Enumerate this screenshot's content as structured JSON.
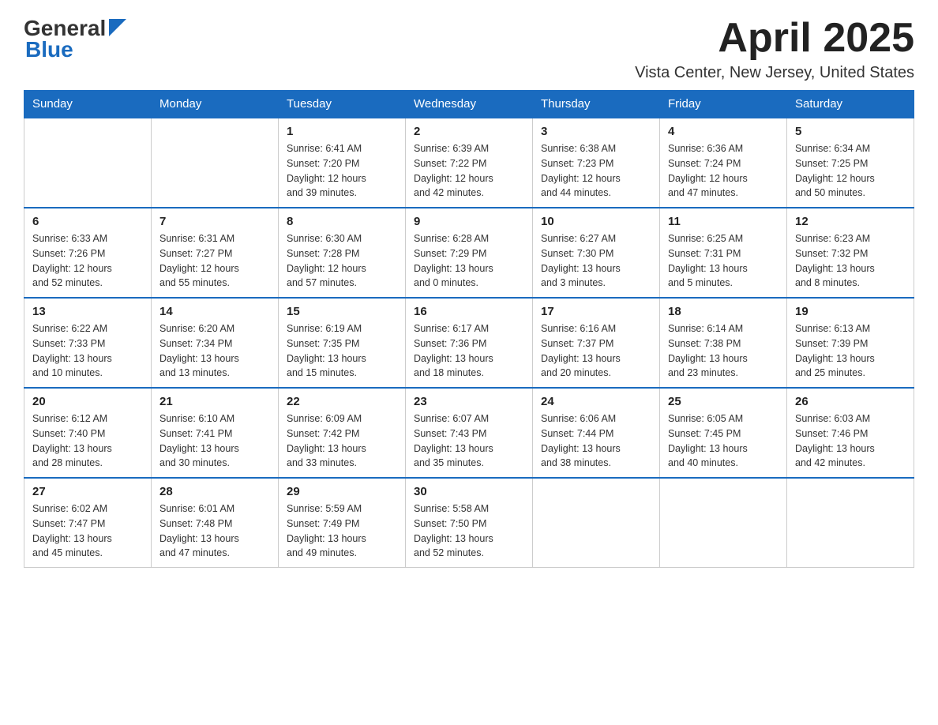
{
  "header": {
    "logo_line1": "General",
    "logo_line2": "Blue",
    "month": "April 2025",
    "location": "Vista Center, New Jersey, United States"
  },
  "weekdays": [
    "Sunday",
    "Monday",
    "Tuesday",
    "Wednesday",
    "Thursday",
    "Friday",
    "Saturday"
  ],
  "weeks": [
    [
      {
        "day": "",
        "info": ""
      },
      {
        "day": "",
        "info": ""
      },
      {
        "day": "1",
        "info": "Sunrise: 6:41 AM\nSunset: 7:20 PM\nDaylight: 12 hours\nand 39 minutes."
      },
      {
        "day": "2",
        "info": "Sunrise: 6:39 AM\nSunset: 7:22 PM\nDaylight: 12 hours\nand 42 minutes."
      },
      {
        "day": "3",
        "info": "Sunrise: 6:38 AM\nSunset: 7:23 PM\nDaylight: 12 hours\nand 44 minutes."
      },
      {
        "day": "4",
        "info": "Sunrise: 6:36 AM\nSunset: 7:24 PM\nDaylight: 12 hours\nand 47 minutes."
      },
      {
        "day": "5",
        "info": "Sunrise: 6:34 AM\nSunset: 7:25 PM\nDaylight: 12 hours\nand 50 minutes."
      }
    ],
    [
      {
        "day": "6",
        "info": "Sunrise: 6:33 AM\nSunset: 7:26 PM\nDaylight: 12 hours\nand 52 minutes."
      },
      {
        "day": "7",
        "info": "Sunrise: 6:31 AM\nSunset: 7:27 PM\nDaylight: 12 hours\nand 55 minutes."
      },
      {
        "day": "8",
        "info": "Sunrise: 6:30 AM\nSunset: 7:28 PM\nDaylight: 12 hours\nand 57 minutes."
      },
      {
        "day": "9",
        "info": "Sunrise: 6:28 AM\nSunset: 7:29 PM\nDaylight: 13 hours\nand 0 minutes."
      },
      {
        "day": "10",
        "info": "Sunrise: 6:27 AM\nSunset: 7:30 PM\nDaylight: 13 hours\nand 3 minutes."
      },
      {
        "day": "11",
        "info": "Sunrise: 6:25 AM\nSunset: 7:31 PM\nDaylight: 13 hours\nand 5 minutes."
      },
      {
        "day": "12",
        "info": "Sunrise: 6:23 AM\nSunset: 7:32 PM\nDaylight: 13 hours\nand 8 minutes."
      }
    ],
    [
      {
        "day": "13",
        "info": "Sunrise: 6:22 AM\nSunset: 7:33 PM\nDaylight: 13 hours\nand 10 minutes."
      },
      {
        "day": "14",
        "info": "Sunrise: 6:20 AM\nSunset: 7:34 PM\nDaylight: 13 hours\nand 13 minutes."
      },
      {
        "day": "15",
        "info": "Sunrise: 6:19 AM\nSunset: 7:35 PM\nDaylight: 13 hours\nand 15 minutes."
      },
      {
        "day": "16",
        "info": "Sunrise: 6:17 AM\nSunset: 7:36 PM\nDaylight: 13 hours\nand 18 minutes."
      },
      {
        "day": "17",
        "info": "Sunrise: 6:16 AM\nSunset: 7:37 PM\nDaylight: 13 hours\nand 20 minutes."
      },
      {
        "day": "18",
        "info": "Sunrise: 6:14 AM\nSunset: 7:38 PM\nDaylight: 13 hours\nand 23 minutes."
      },
      {
        "day": "19",
        "info": "Sunrise: 6:13 AM\nSunset: 7:39 PM\nDaylight: 13 hours\nand 25 minutes."
      }
    ],
    [
      {
        "day": "20",
        "info": "Sunrise: 6:12 AM\nSunset: 7:40 PM\nDaylight: 13 hours\nand 28 minutes."
      },
      {
        "day": "21",
        "info": "Sunrise: 6:10 AM\nSunset: 7:41 PM\nDaylight: 13 hours\nand 30 minutes."
      },
      {
        "day": "22",
        "info": "Sunrise: 6:09 AM\nSunset: 7:42 PM\nDaylight: 13 hours\nand 33 minutes."
      },
      {
        "day": "23",
        "info": "Sunrise: 6:07 AM\nSunset: 7:43 PM\nDaylight: 13 hours\nand 35 minutes."
      },
      {
        "day": "24",
        "info": "Sunrise: 6:06 AM\nSunset: 7:44 PM\nDaylight: 13 hours\nand 38 minutes."
      },
      {
        "day": "25",
        "info": "Sunrise: 6:05 AM\nSunset: 7:45 PM\nDaylight: 13 hours\nand 40 minutes."
      },
      {
        "day": "26",
        "info": "Sunrise: 6:03 AM\nSunset: 7:46 PM\nDaylight: 13 hours\nand 42 minutes."
      }
    ],
    [
      {
        "day": "27",
        "info": "Sunrise: 6:02 AM\nSunset: 7:47 PM\nDaylight: 13 hours\nand 45 minutes."
      },
      {
        "day": "28",
        "info": "Sunrise: 6:01 AM\nSunset: 7:48 PM\nDaylight: 13 hours\nand 47 minutes."
      },
      {
        "day": "29",
        "info": "Sunrise: 5:59 AM\nSunset: 7:49 PM\nDaylight: 13 hours\nand 49 minutes."
      },
      {
        "day": "30",
        "info": "Sunrise: 5:58 AM\nSunset: 7:50 PM\nDaylight: 13 hours\nand 52 minutes."
      },
      {
        "day": "",
        "info": ""
      },
      {
        "day": "",
        "info": ""
      },
      {
        "day": "",
        "info": ""
      }
    ]
  ]
}
